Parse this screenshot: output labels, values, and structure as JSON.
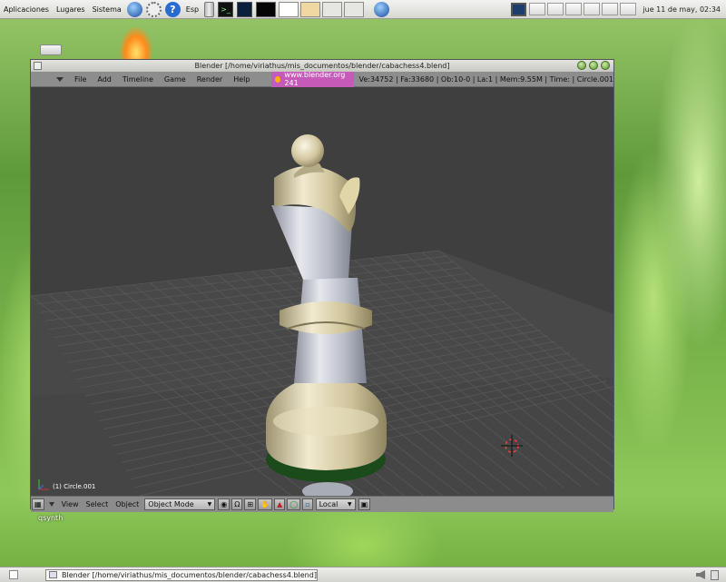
{
  "top_panel": {
    "menus": [
      "Aplicaciones",
      "Lugares",
      "Sistema"
    ],
    "keyboard_layout": "Esp",
    "clock": "jue 11 de may, 02:34",
    "launchers": [
      "globe-icon",
      "settings-icon",
      "help-icon",
      "trash-can-icon",
      "terminal-icon",
      "system-monitor-icon",
      "black-window-icon"
    ]
  },
  "window": {
    "title": "Blender [/home/viriathus/mis_documentos/blender/cabachess4.blend]"
  },
  "blender": {
    "menus": [
      "File",
      "Add",
      "Timeline",
      "Game",
      "Render",
      "Help"
    ],
    "url_badge": "www.blender.org 241",
    "stats": "Ve:34752 | Fa:33680 | Ob:10-0 | La:1  | Mem:9.55M  | Time: | Circle.001",
    "object_label": "(1) Circle.001",
    "header_menus": [
      "View",
      "Select",
      "Object"
    ],
    "mode": "Object Mode",
    "orientation": "Local"
  },
  "desktop": {
    "qsynth_label": "qsynth"
  },
  "taskbar": {
    "task_label": "Blender [/home/viriathus/mis_documentos/blender/cabachess4.blend]"
  },
  "colors": {
    "viewport_bg": "#3f3f3f",
    "grid_line": "#5a5a5a",
    "url_badge": "#c55ab9",
    "piece_silver": "#b9bcc6",
    "piece_cream": "#d8cfa6"
  }
}
